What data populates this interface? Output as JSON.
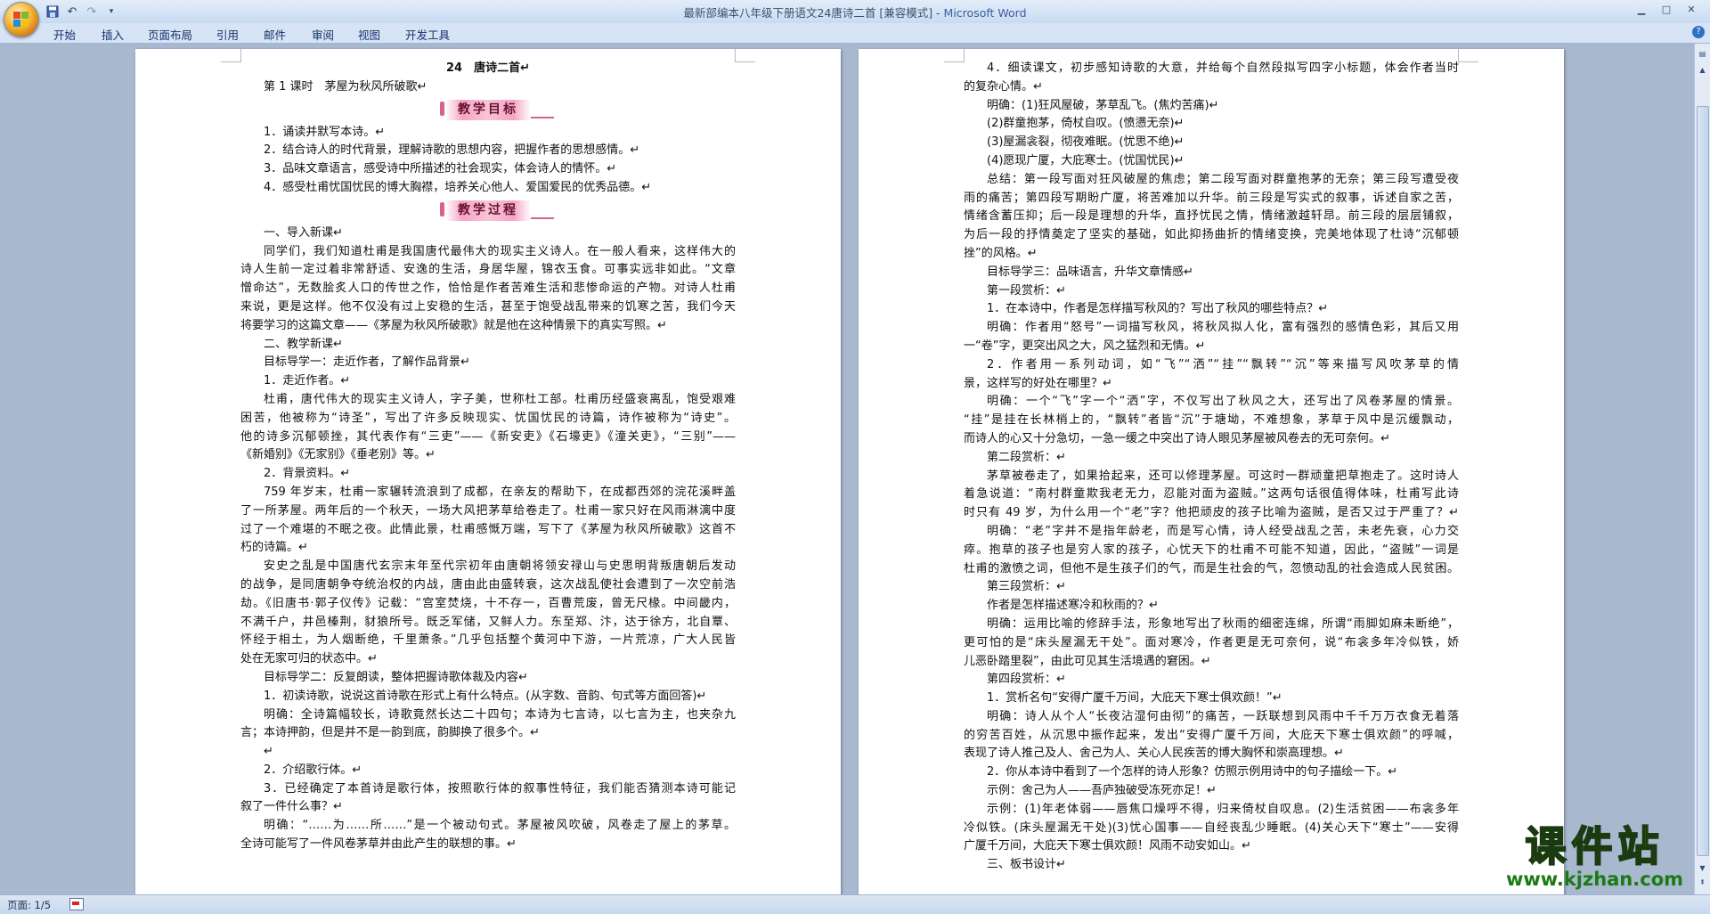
{
  "window": {
    "title": "最新部编本八年级下册语文24唐诗二首 [兼容模式] - ",
    "app_name": "Microsoft Word",
    "minimize_icon": "minimize-icon",
    "maximize_icon": "maximize-icon",
    "close_icon": "close-icon"
  },
  "ribbon": {
    "tabs": [
      "开始",
      "插入",
      "页面布局",
      "引用",
      "邮件",
      "审阅",
      "视图",
      "开发工具"
    ]
  },
  "status": {
    "page": "页面: 1/5"
  },
  "watermark": {
    "main": "课件站",
    "url": "www.kjzhan.com"
  },
  "page_left": {
    "lines": [
      {
        "t": "24　唐诗二首↵",
        "s": "c b"
      },
      {
        "t": "第 1 课时　茅屋为秋风所破歌↵",
        "s": "i1"
      },
      {
        "t": "教学目标",
        "s": "banner"
      },
      {
        "t": "1．诵读并默写本诗。↵",
        "s": "i1"
      },
      {
        "t": "2．结合诗人的时代背景，理解诗歌的思想内容，把握作者的思想感情。↵",
        "s": "i1"
      },
      {
        "t": "3．品味文章语言，感受诗中所描述的社会现实，体会诗人的情怀。↵",
        "s": "i1"
      },
      {
        "t": "4．感受杜甫忧国忧民的博大胸襟，培养关心他人、爱国爱民的优秀品德。↵",
        "s": "i1"
      },
      {
        "t": "教学过程",
        "s": "banner"
      },
      {
        "t": "一、导入新课↵",
        "s": "i1"
      },
      {
        "t": "同学们，我们知道杜甫是我国唐代最伟大的现实主义诗人。在一般人看来，这样伟大的",
        "s": "i1 j"
      },
      {
        "t": "诗人生前一定过着非常舒适、安逸的生活，身居华屋，锦衣玉食。可事实远非如此。“文章",
        "s": "j"
      },
      {
        "t": "憎命达”，无数脍炙人口的传世之作，恰恰是作者苦难生活和悲惨命运的产物。对诗人杜甫",
        "s": "j"
      },
      {
        "t": "来说，更是这样。他不仅没有过上安稳的生活，甚至于饱受战乱带来的饥寒之苦，我们今天",
        "s": "j"
      },
      {
        "t": "将要学习的这篇文章——《茅屋为秋风所破歌》就是他在这种情景下的真实写照。↵",
        "s": ""
      },
      {
        "t": "二、教学新课↵",
        "s": "i1"
      },
      {
        "t": "目标导学一：走近作者，了解作品背景↵",
        "s": "i1"
      },
      {
        "t": "1．走近作者。↵",
        "s": "i1"
      },
      {
        "t": "杜甫，唐代伟大的现实主义诗人，字子美，世称杜工部。杜甫历经盛衰离乱，饱受艰难",
        "s": "i1 j"
      },
      {
        "t": "困苦，他被称为“诗圣”，写出了许多反映现实、忧国忧民的诗篇，诗作被称为“诗史”。",
        "s": "j"
      },
      {
        "t": "他的诗多沉郁顿挫，其代表作有“三吏”——《新安吏》《石壕吏》《潼关吏》，“三别”——",
        "s": "j"
      },
      {
        "t": "《新婚别》《无家别》《垂老别》等。↵",
        "s": ""
      },
      {
        "t": "2．背景资料。↵",
        "s": "i1"
      },
      {
        "t": "759 年岁末，杜甫一家辗转流浪到了成都，在亲友的帮助下，在成都西郊的浣花溪畔盖",
        "s": "i1 j"
      },
      {
        "t": "了一所茅屋。两年后的一个秋天，一场大风把茅草给卷走了。杜甫一家只好在风雨淋漓中度",
        "s": "j"
      },
      {
        "t": "过了一个难堪的不眠之夜。此情此景，杜甫感慨万端，写下了《茅屋为秋风所破歌》这首不",
        "s": "j"
      },
      {
        "t": "朽的诗篇。↵",
        "s": ""
      },
      {
        "t": "安史之乱是中国唐代玄宗末年至代宗初年由唐朝将领安禄山与史思明背叛唐朝后发动",
        "s": "i1 j"
      },
      {
        "t": "的战争，是同唐朝争夺统治权的内战，唐由此由盛转衰，这次战乱使社会遭到了一次空前浩",
        "s": "j"
      },
      {
        "t": "劫。《旧唐书·郭子仪传》记载：“宫室焚烧，十不存一，百曹荒废，曾无尺椽。中间畿内，",
        "s": "j"
      },
      {
        "t": "不满千户，井邑榛荆，豺狼所号。既乏军储，又鲜人力。东至郑、汴，达于徐方，北自覃、",
        "s": "j"
      },
      {
        "t": "怀经于相土，为人烟断绝，千里萧条。”几乎包括整个黄河中下游，一片荒凉，广大人民皆",
        "s": "j"
      },
      {
        "t": "处在无家可归的状态中。↵",
        "s": ""
      },
      {
        "t": "目标导学二：反复朗读，整体把握诗歌体裁及内容↵",
        "s": "i1"
      },
      {
        "t": "1．初读诗歌，说说这首诗歌在形式上有什么特点。(从字数、音韵、句式等方面回答)↵",
        "s": "i1"
      },
      {
        "t": "明确：全诗篇幅较长，诗歌竟然长达二十四句；本诗为七言诗，以七言为主，也夹杂九",
        "s": "i1 j"
      },
      {
        "t": "言；本诗押韵，但是并不是一韵到底，韵脚换了很多个。↵",
        "s": ""
      },
      {
        "t": "↵",
        "s": "i1"
      },
      {
        "t": "2．介绍歌行体。↵",
        "s": "i1"
      },
      {
        "t": "3．已经确定了本首诗是歌行体，按照歌行体的叙事性特征，我们能否猜测本诗可能记",
        "s": "i1 j"
      },
      {
        "t": "叙了一件什么事？↵",
        "s": ""
      },
      {
        "t": "明确：“……为……所……”是一个被动句式。茅屋被风吹破，风卷走了屋上的茅草。",
        "s": "i1 j"
      },
      {
        "t": "全诗可能写了一件风卷茅草并由此产生的联想的事。↵",
        "s": ""
      }
    ]
  },
  "page_right": {
    "lines": [
      {
        "t": "4．细读课文，初步感知诗歌的大意，并给每个自然段拟写四字小标题，体会作者当时",
        "s": "i1 j"
      },
      {
        "t": "的复杂心情。↵",
        "s": ""
      },
      {
        "t": "明确：(1)狂风屋破，茅草乱飞。(焦灼苦痛)↵",
        "s": "i1"
      },
      {
        "t": "(2)群童抱茅，倚杖自叹。(愤懑无奈)↵",
        "s": "i1"
      },
      {
        "t": "(3)屋漏衾裂，彻夜难眠。(忧思不绝)↵",
        "s": "i1"
      },
      {
        "t": "(4)愿现广厦，大庇寒士。(忧国忧民)↵",
        "s": "i1"
      },
      {
        "t": "总结：第一段写面对狂风破屋的焦虑；第二段写面对群童抱茅的无奈；第三段写遭受夜",
        "s": "i1 j"
      },
      {
        "t": "雨的痛苦；第四段写期盼广厦，将苦难加以升华。前三段是写实式的叙事，诉述自家之苦，",
        "s": "j"
      },
      {
        "t": "情绪含蓄压抑；后一段是理想的升华，直抒忧民之情，情绪激越轩昂。前三段的层层铺叙，",
        "s": "j"
      },
      {
        "t": "为后一段的抒情奠定了坚实的基础，如此抑扬曲折的情绪变换，完美地体现了杜诗“沉郁顿",
        "s": "j"
      },
      {
        "t": "挫”的风格。↵",
        "s": ""
      },
      {
        "t": "目标导学三：品味语言，升华文章情感↵",
        "s": "i1"
      },
      {
        "t": "第一段赏析：↵",
        "s": "i1"
      },
      {
        "t": "1．在本诗中，作者是怎样描写秋风的？写出了秋风的哪些特点？↵",
        "s": "i1"
      },
      {
        "t": "明确：作者用“怒号”一词描写秋风，将秋风拟人化，富有强烈的感情色彩，其后又用",
        "s": "i1 j"
      },
      {
        "t": "一“卷”字，更突出风之大，风之猛烈和无情。↵",
        "s": ""
      },
      {
        "t": "2．作者用一系列动词，如“飞”“洒”“挂”“飘转”“沉”等来描写风吹茅草的情",
        "s": "i1 j"
      },
      {
        "t": "景，这样写的好处在哪里？↵",
        "s": ""
      },
      {
        "t": "明确：一个“飞”字一个“洒”字，不仅写出了秋风之大，还写出了风卷茅屋的情景。",
        "s": "i1 j"
      },
      {
        "t": "“挂”是挂在长林梢上的，“飘转”者皆“沉”于塘坳，不难想象，茅草于风中是沉缓飘动，",
        "s": "j"
      },
      {
        "t": "而诗人的心又十分急切，一急一缓之中突出了诗人眼见茅屋被风卷去的无可奈何。↵",
        "s": ""
      },
      {
        "t": "第二段赏析：↵",
        "s": "i1"
      },
      {
        "t": "茅草被卷走了，如果拾起来，还可以修理茅屋。可这时一群顽童把草抱走了。这时诗人",
        "s": "i1 j"
      },
      {
        "t": "着急说道：“南村群童欺我老无力，忍能对面为盗贼。”这两句话很值得体味，杜甫写此诗",
        "s": "j"
      },
      {
        "t": "时只有 49 岁，为什么用一个“老”字？他把顽皮的孩子比喻为盗贼，是否又过于严重了？↵",
        "s": "j"
      },
      {
        "t": "明确：“老”字并不是指年龄老，而是写心情，诗人经受战乱之苦，未老先衰，心力交",
        "s": "i1 j"
      },
      {
        "t": "瘁。抱草的孩子也是穷人家的孩子，心忧天下的杜甫不可能不知道，因此，“盗贼”一词是",
        "s": "j"
      },
      {
        "t": "杜甫的激愤之词，但他不是生孩子们的气，而是生社会的气，忽愤动乱的社会造成人民贫困。",
        "s": "j"
      },
      {
        "t": "第三段赏析：↵",
        "s": "i1"
      },
      {
        "t": "作者是怎样描述寒冷和秋雨的？↵",
        "s": "i1"
      },
      {
        "t": "明确：运用比喻的修辞手法，形象地写出了秋雨的细密连绵，所谓“雨脚如麻未断绝”，",
        "s": "i1 j"
      },
      {
        "t": "更可怕的是“床头屋漏无干处”。面对寒冷，作者更是无可奈何，说“布衾多年冷似铁，娇",
        "s": "j"
      },
      {
        "t": "儿恶卧踏里裂”，由此可见其生活境遇的窘困。↵",
        "s": ""
      },
      {
        "t": "第四段赏析：↵",
        "s": "i1"
      },
      {
        "t": "1．赏析名句“安得广厦千万间，大庇天下寒士俱欢颜！”↵",
        "s": "i1"
      },
      {
        "t": "明确：诗人从个人“长夜沾湿何由彻”的痛苦，一跃联想到风雨中千千万万衣食无着落",
        "s": "i1 j"
      },
      {
        "t": "的穷苦百姓，从沉思中振作起来，发出“安得广厦千万间，大庇天下寒士俱欢颜”的呼喊，",
        "s": "j"
      },
      {
        "t": "表现了诗人推己及人、舍己为人、关心人民疾苦的博大胸怀和崇高理想。↵",
        "s": ""
      },
      {
        "t": "2．你从本诗中看到了一个怎样的诗人形象？仿照示例用诗中的句子描绘一下。↵",
        "s": "i1"
      },
      {
        "t": "示例：舍己为人——吾庐独破受冻死亦足！↵",
        "s": "i1"
      },
      {
        "t": "示例：(1)年老体弱——唇焦口燥呼不得，归来倚杖自叹息。(2)生活贫困——布衾多年",
        "s": "i1 j"
      },
      {
        "t": "冷似铁。(床头屋漏无干处)(3)忧心国事——自经丧乱少睡眠。(4)关心天下“寒士”——安得",
        "s": "j"
      },
      {
        "t": "广厦千万间，大庇天下寒士俱欢颜！风雨不动安如山。↵",
        "s": ""
      },
      {
        "t": "三、板书设计↵",
        "s": "i1"
      }
    ]
  }
}
